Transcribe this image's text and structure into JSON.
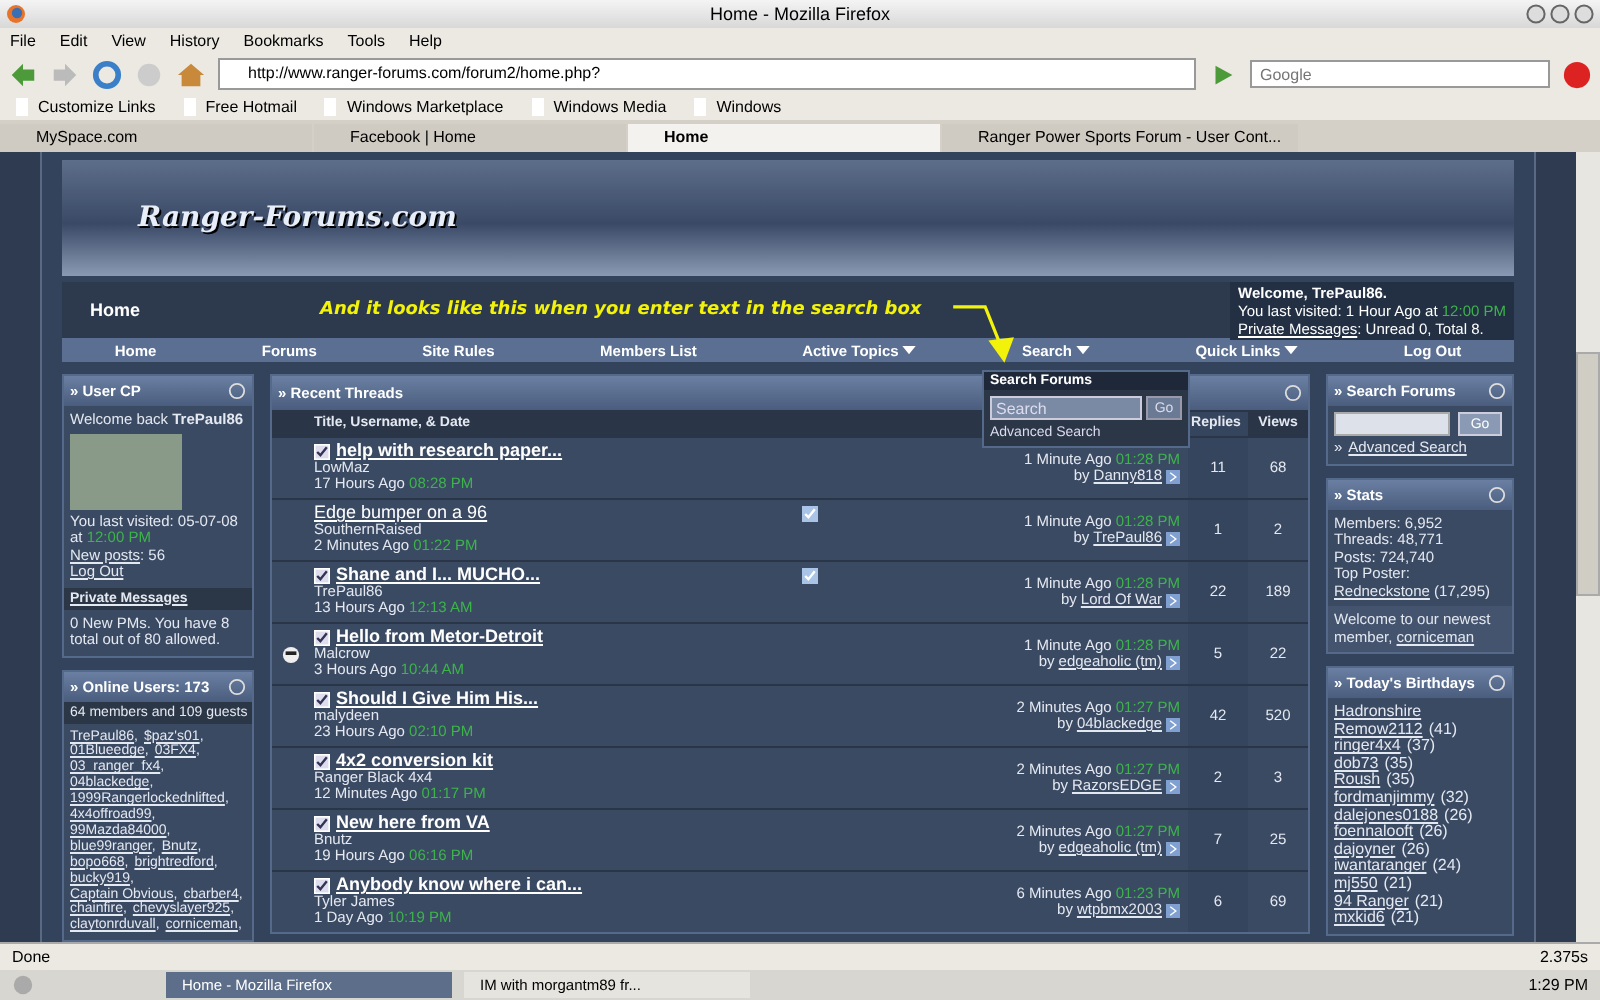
{
  "window": {
    "title": "Home - Mozilla Firefox"
  },
  "menu": [
    "File",
    "Edit",
    "View",
    "History",
    "Bookmarks",
    "Tools",
    "Help"
  ],
  "address": "http://www.ranger-forums.com/forum2/home.php?",
  "web_search": {
    "placeholder": "Google"
  },
  "bookmarks": [
    "Customize Links",
    "Free Hotmail",
    "Windows Marketplace",
    "Windows Media",
    "Windows"
  ],
  "tabs": [
    {
      "label": "MySpace.com",
      "selected": false
    },
    {
      "label": "Facebook | Home",
      "selected": false
    },
    {
      "label": "Home",
      "selected": true
    },
    {
      "label": "Ranger Power Sports Forum - User Cont...",
      "selected": false
    }
  ],
  "site": {
    "logo": "Ranger-Forums.com",
    "breadcrumb": "Home",
    "annotation": "And it looks like this when you enter text in the search box",
    "welcome": {
      "greeting": "Welcome, TrePaul86.",
      "last_visited": "You last visited: 1 Hour Ago at",
      "time": "12:00 PM",
      "pm_link": "Private Messages",
      "pm_text": ": Unread 0, Total 8."
    }
  },
  "nav": [
    {
      "label": "Home",
      "dropdown": false
    },
    {
      "label": "Forums",
      "dropdown": false
    },
    {
      "label": "Site Rules",
      "dropdown": false
    },
    {
      "label": "Members List",
      "dropdown": false
    },
    {
      "label": "Active Topics",
      "dropdown": true
    },
    {
      "label": "Search",
      "dropdown": true
    },
    {
      "label": "Quick Links",
      "dropdown": true
    },
    {
      "label": "Log Out",
      "dropdown": false
    }
  ],
  "search_popup": {
    "title": "Search Forums",
    "value": "Search",
    "button": "Go",
    "link": "Advanced Search"
  },
  "user_cp": {
    "title": "» User CP",
    "welcome": "Welcome back **TrePaul86**",
    "last_visited": "You last visited: 05-07-08 at",
    "time": "12:00 PM",
    "new_posts_link": "New posts",
    "new_posts_count": ": 56",
    "logout": "Log Out",
    "pm_heading": "Private Messages",
    "pm_text": "0 New PMs. You have 8 total out of 80 allowed."
  },
  "online": {
    "title": "» Online Users: 173",
    "summary": "64 members and 109 guests",
    "separator": ",",
    "users": [
      "TrePaul86",
      "$paz's01",
      "01Blueedge",
      "03FX4",
      "03_ranger_fx4",
      "04blackedge",
      "1999Rangerlockednlifted",
      "4x4offroad99",
      "99Mazda84000",
      "blue99ranger",
      "Bnutz",
      "bopo668",
      "brightredford",
      "bucky919",
      "Captain Obvious",
      "cbarber4",
      "chainfire",
      "chevyslayer925",
      "claytonrduvall",
      "corniceman"
    ]
  },
  "threads": {
    "title": "» Recent Threads",
    "columns": [
      "Title, Username, & Date",
      "Replies",
      "Views"
    ],
    "rows": [
      {
        "title": "help with research paper...",
        "bold": true,
        "read_icon": true,
        "flag": false,
        "status_icon": false,
        "author": "LowMaz",
        "age": "17 Hours Ago",
        "time": "08:28 PM",
        "last_age": "1 Minute Ago",
        "last_time": "01:28 PM",
        "by_label": "by",
        "last_by": "Danny818",
        "replies": "11",
        "views": "68"
      },
      {
        "title": "Edge bumper on a 96",
        "bold": false,
        "read_icon": false,
        "flag": true,
        "status_icon": false,
        "author": "SouthernRaised",
        "age": "2 Minutes Ago",
        "time": "01:22 PM",
        "last_age": "1 Minute Ago",
        "last_time": "01:28 PM",
        "by_label": "by",
        "last_by": "TrePaul86",
        "replies": "1",
        "views": "2"
      },
      {
        "title": "Shane and I... MUCHO...",
        "bold": true,
        "read_icon": true,
        "flag": true,
        "status_icon": false,
        "author": "TrePaul86",
        "age": "13 Hours Ago",
        "time": "12:13 AM",
        "last_age": "1 Minute Ago",
        "last_time": "01:28 PM",
        "by_label": "by",
        "last_by": "Lord Of War",
        "replies": "22",
        "views": "189"
      },
      {
        "title": "Hello from Metor-Detroit",
        "bold": true,
        "read_icon": true,
        "flag": false,
        "status_icon": true,
        "author": "Malcrow",
        "age": "3 Hours Ago",
        "time": "10:44 AM",
        "last_age": "1 Minute Ago",
        "last_time": "01:28 PM",
        "by_label": "by",
        "last_by": "edgeaholic (tm)",
        "replies": "5",
        "views": "22"
      },
      {
        "title": "Should I Give Him His...",
        "bold": true,
        "read_icon": true,
        "flag": false,
        "status_icon": false,
        "author": "malydeen",
        "age": "23 Hours Ago",
        "time": "02:10 PM",
        "last_age": "2 Minutes Ago",
        "last_time": "01:27 PM",
        "by_label": "by",
        "last_by": "04blackedge",
        "replies": "42",
        "views": "520"
      },
      {
        "title": "4x2 conversion kit",
        "bold": true,
        "read_icon": true,
        "flag": false,
        "status_icon": false,
        "author": "Ranger Black 4x4",
        "age": "12 Minutes Ago",
        "time": "01:17 PM",
        "last_age": "2 Minutes Ago",
        "last_time": "01:27 PM",
        "by_label": "by",
        "last_by": "RazorsEDGE",
        "replies": "2",
        "views": "3"
      },
      {
        "title": "New here from VA",
        "bold": true,
        "read_icon": true,
        "flag": false,
        "status_icon": false,
        "author": "Bnutz",
        "age": "19 Hours Ago",
        "time": "06:16 PM",
        "last_age": "2 Minutes Ago",
        "last_time": "01:27 PM",
        "by_label": "by",
        "last_by": "edgeaholic (tm)",
        "replies": "7",
        "views": "25"
      },
      {
        "title": "Anybody know where i can...",
        "bold": true,
        "read_icon": true,
        "flag": false,
        "status_icon": false,
        "author": "Tyler James",
        "age": "1 Day Ago",
        "time": "10:19 PM",
        "last_age": "6 Minutes Ago",
        "last_time": "01:23 PM",
        "by_label": "by",
        "last_by": "wtpbmx2003",
        "replies": "6",
        "views": "69"
      }
    ]
  },
  "search_box": {
    "title": "» Search Forums",
    "button": "Go",
    "link_prefix": "»",
    "link": "Advanced Search"
  },
  "stats": {
    "title": "» Stats",
    "lines": [
      "Members: 6,952",
      "Threads: 48,771",
      "Posts: 724,740"
    ],
    "top_label": "Top Poster: ",
    "top_user": "Redneckstone",
    "top_count": "(17,295)",
    "newest_text": "Welcome to our newest member, ",
    "newest_user": "corniceman"
  },
  "birthdays": {
    "title": "» Today's Birthdays",
    "people": [
      {
        "name": "Hadronshire"
      },
      {
        "name": "Remow2112",
        "age": "(41)"
      },
      {
        "name": "ringer4x4",
        "age": "(37)"
      },
      {
        "name": "dob73",
        "age": "(35)"
      },
      {
        "name": "Roush",
        "age": "(35)"
      },
      {
        "name": "fordmanjimmy",
        "age": "(32)"
      },
      {
        "name": "dalejones0188",
        "age": "(26)"
      },
      {
        "name": "foennalooft",
        "age": "(26)"
      },
      {
        "name": "dajoyner",
        "age": "(26)"
      },
      {
        "name": "iwantaranger",
        "age": "(24)"
      },
      {
        "name": "mj550",
        "age": "(21)"
      },
      {
        "name": "94 Ranger",
        "age": "(21)"
      },
      {
        "name": "mxkid6",
        "age": "(21)"
      }
    ]
  },
  "status_bar": {
    "text": "Done",
    "timing": "2.375s"
  },
  "taskbar": {
    "windows": [
      {
        "label": "Home - Mozilla Firefox",
        "selected": true
      },
      {
        "label": "IM with morgantm89 fr...",
        "selected": false
      }
    ],
    "clock": "1:29 PM"
  }
}
